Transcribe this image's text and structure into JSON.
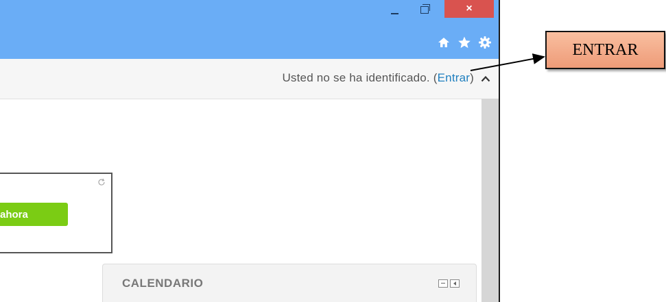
{
  "window": {
    "controls": {
      "minimize_icon": "minimize-icon",
      "maximize_icon": "restore-icon",
      "close_label": "×"
    },
    "toolbar_icons": [
      "home-icon",
      "star-icon",
      "gear-icon"
    ]
  },
  "navbar": {
    "login_prefix": "Usted no se ha identificado. (",
    "login_link": "Entrar",
    "login_suffix": ")"
  },
  "content": {
    "button_label": "ahora"
  },
  "calendar": {
    "title": "CALENDARIO"
  },
  "annotation": {
    "callout_label": "ENTRAR"
  },
  "colors": {
    "titlebar": "#6aadf6",
    "close": "#d9534f",
    "link": "#1f7fbf",
    "button": "#7bcc14",
    "callout": "#f3a989"
  }
}
